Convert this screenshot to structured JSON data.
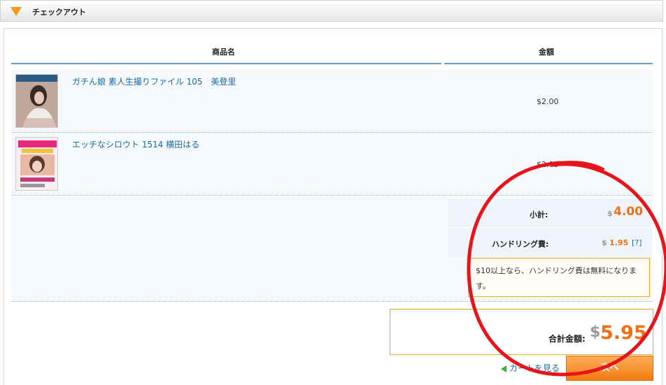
{
  "header": {
    "title": "チェックアウト"
  },
  "table": {
    "col_name": "商品名",
    "col_price": "金額"
  },
  "items": [
    {
      "name": "ガチん娘 素人生撮りファイル 105　美登里",
      "price": "$2.00"
    },
    {
      "name": "エッチなシロウト 1514 横田はる",
      "price": "$2.00"
    }
  ],
  "summary": {
    "subtotal_label": "小計:",
    "subtotal_currency": "$",
    "subtotal_value": "4.00",
    "handling_label": "ハンドリング費:",
    "handling_currency": "$",
    "handling_value": "1.95",
    "help_link": "[?]",
    "notice": "$10以上なら、ハンドリング費は無料になります。"
  },
  "total": {
    "label": "合計金額:",
    "currency": "$",
    "value": "5.95"
  },
  "actions": {
    "back_label": "カートを見る",
    "next_label": "次へ"
  },
  "colors": {
    "accent": "#f36f13",
    "link": "#1a6aa8",
    "border_orange": "#f5a623",
    "annotation": "#e8141b"
  }
}
